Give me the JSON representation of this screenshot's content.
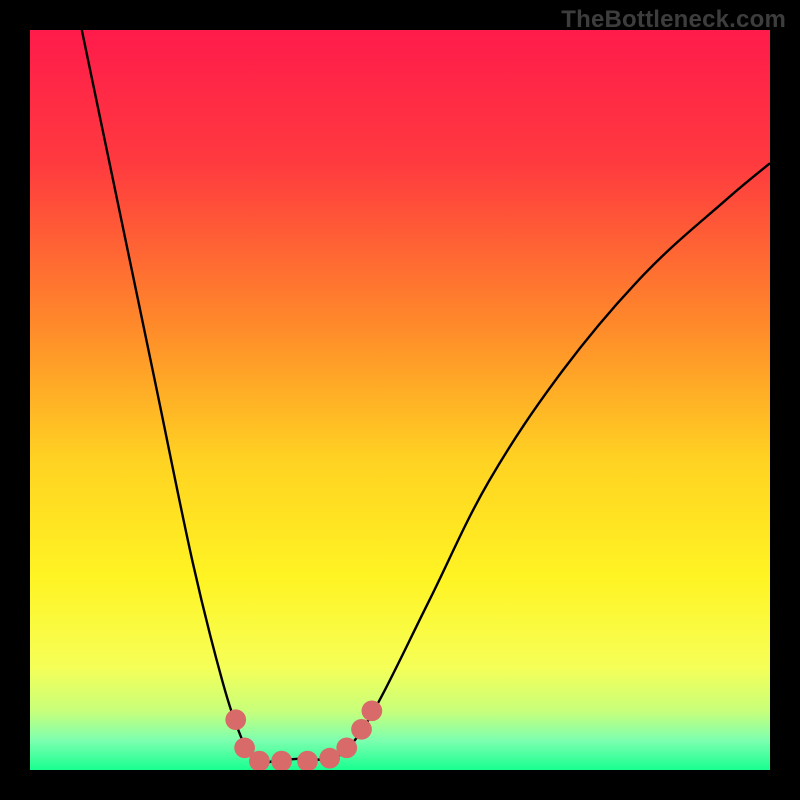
{
  "watermark": "TheBottleneck.com",
  "chart_data": {
    "type": "line",
    "title": "",
    "xlabel": "",
    "ylabel": "",
    "xlim": [
      0,
      1
    ],
    "ylim": [
      0,
      1
    ],
    "series": [
      {
        "name": "bottleneck-curve",
        "x": [
          0.07,
          0.12,
          0.17,
          0.22,
          0.26,
          0.285,
          0.3,
          0.315,
          0.33,
          0.36,
          0.4,
          0.43,
          0.47,
          0.54,
          0.62,
          0.72,
          0.83,
          0.94,
          1.0
        ],
        "y": [
          1.0,
          0.76,
          0.52,
          0.28,
          0.12,
          0.045,
          0.018,
          0.01,
          0.012,
          0.015,
          0.015,
          0.03,
          0.09,
          0.23,
          0.39,
          0.54,
          0.67,
          0.77,
          0.82
        ]
      }
    ],
    "markers": {
      "name": "trough-markers",
      "color": "#d86a6a",
      "radius_rel": 0.014,
      "points": [
        {
          "x": 0.278,
          "y": 0.068
        },
        {
          "x": 0.29,
          "y": 0.03
        },
        {
          "x": 0.31,
          "y": 0.012
        },
        {
          "x": 0.34,
          "y": 0.012
        },
        {
          "x": 0.375,
          "y": 0.012
        },
        {
          "x": 0.405,
          "y": 0.016
        },
        {
          "x": 0.428,
          "y": 0.03
        },
        {
          "x": 0.448,
          "y": 0.055
        },
        {
          "x": 0.462,
          "y": 0.08
        }
      ]
    },
    "gradient_stops": [
      {
        "pos": 0.0,
        "color": "#ff1b4b"
      },
      {
        "pos": 0.18,
        "color": "#ff3a3f"
      },
      {
        "pos": 0.4,
        "color": "#ff8a2a"
      },
      {
        "pos": 0.58,
        "color": "#ffd222"
      },
      {
        "pos": 0.74,
        "color": "#fff423"
      },
      {
        "pos": 0.86,
        "color": "#f6ff57"
      },
      {
        "pos": 0.92,
        "color": "#c8ff7a"
      },
      {
        "pos": 0.96,
        "color": "#7dffb0"
      },
      {
        "pos": 1.0,
        "color": "#18ff8f"
      }
    ]
  }
}
